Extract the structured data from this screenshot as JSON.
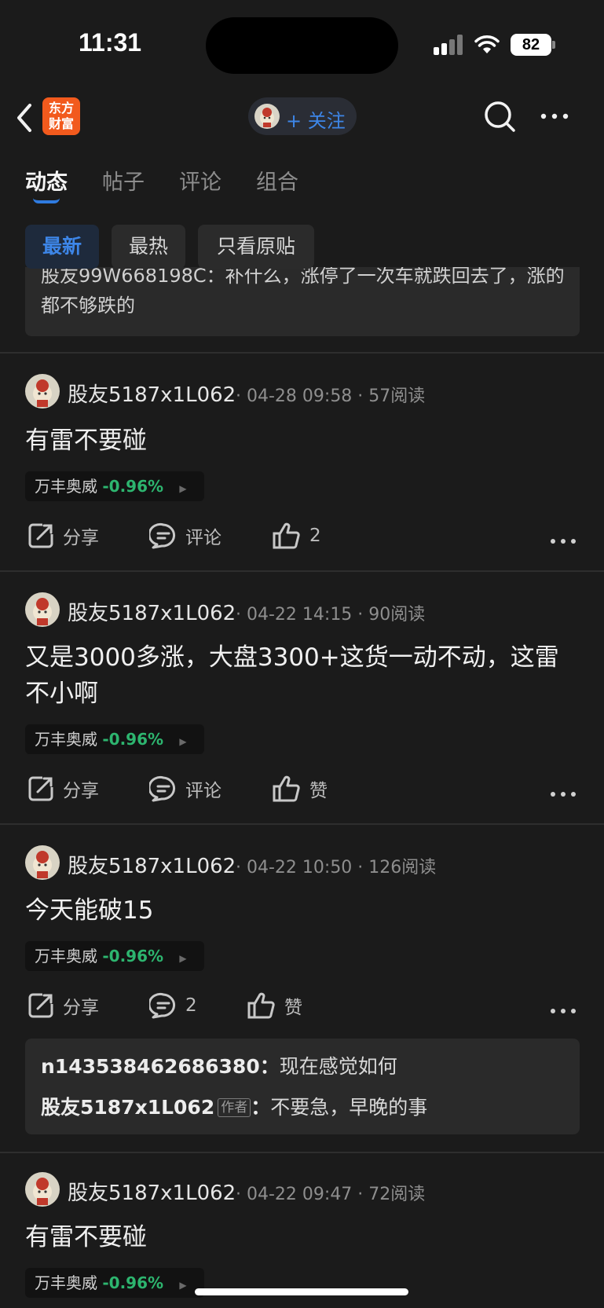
{
  "status_bar": {
    "time": "11:31",
    "battery": "82"
  },
  "nav": {
    "logo_line1": "东方",
    "logo_line2": "财富",
    "follow_label": "+ 关注"
  },
  "tabs": [
    {
      "label": "动态",
      "active": true
    },
    {
      "label": "帖子",
      "active": false
    },
    {
      "label": "评论",
      "active": false
    },
    {
      "label": "组合",
      "active": false
    }
  ],
  "filters": [
    {
      "label": "最新",
      "active": true
    },
    {
      "label": "最热",
      "active": false
    },
    {
      "label": "只看原贴",
      "active": false
    }
  ],
  "previous_quote": {
    "text": "股友99W668198C：补什么，涨停了一次车就跌回去了，涨的都不够跌的"
  },
  "posts": [
    {
      "author": "股友5187x1L062",
      "meta": "· 04-28 09:58 · 57阅读",
      "body": "有雷不要碰",
      "stock_name": "万丰奥威",
      "stock_change": "-0.96%",
      "share_label": "分享",
      "comment_label": "评论",
      "like_label": "2"
    },
    {
      "author": "股友5187x1L062",
      "meta": "· 04-22 14:15 · 90阅读",
      "body": "又是3000多涨，大盘3300+这货一动不动，这雷不小啊",
      "stock_name": "万丰奥威",
      "stock_change": "-0.96%",
      "share_label": "分享",
      "comment_label": "评论",
      "like_label": "赞"
    },
    {
      "author": "股友5187x1L062",
      "meta": "· 04-22 10:50 · 126阅读",
      "body": "今天能破15",
      "stock_name": "万丰奥威",
      "stock_change": "-0.96%",
      "share_label": "分享",
      "comment_label": "2",
      "like_label": "赞",
      "comments": [
        {
          "user": "n143538462686380",
          "sep": "：",
          "text": "现在感觉如何",
          "is_author": false
        },
        {
          "user": "股友5187x1L062",
          "badge": "作者",
          "sep": "：",
          "text": "不要急，早晚的事",
          "is_author": true
        }
      ]
    },
    {
      "author": "股友5187x1L062",
      "meta": "· 04-22 09:47 · 72阅读",
      "body": "有雷不要碰",
      "stock_name": "万丰奥威",
      "stock_change": "-0.96%"
    }
  ],
  "colors": {
    "background": "#1b1b1b",
    "accent_blue": "#3d86e8",
    "stock_down_green": "#2db56f",
    "logo_orange": "#f25a1d"
  },
  "icons": [
    "back-chevron-icon",
    "search-icon",
    "more-dots-icon",
    "share-icon",
    "comment-icon",
    "like-thumb-icon",
    "signal-icon",
    "wifi-icon",
    "battery-icon"
  ]
}
